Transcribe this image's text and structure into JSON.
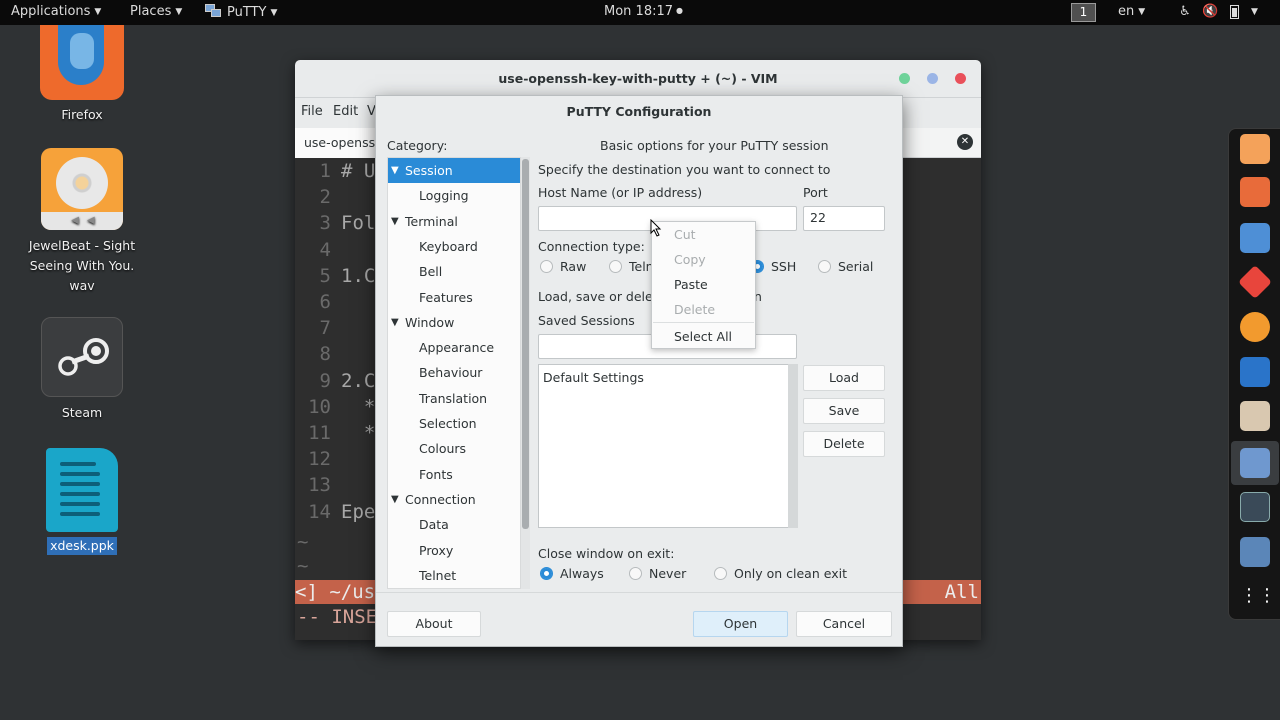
{
  "top_panel": {
    "applications": "Applications",
    "places": "Places",
    "app_menu": "PuTTY",
    "clock": "Mon 18:17",
    "clock_dot": "●",
    "workspace": "1",
    "keyboard_layout": "en"
  },
  "desktop": {
    "icons": [
      {
        "label": "Firefox"
      },
      {
        "label": "JewelBeat - Sight Seeing With You. wav"
      },
      {
        "label": "Steam"
      },
      {
        "label": "xdesk.ppk"
      }
    ]
  },
  "vim_window": {
    "title": "use-openssh-key-with-putty + (~) - VIM",
    "menus": [
      "File",
      "Edit",
      "V"
    ],
    "tab_label": "use-openss",
    "lines": [
      {
        "num": "1",
        "text": "# U"
      },
      {
        "num": "2",
        "text": ""
      },
      {
        "num": "3",
        "text": "Fol"
      },
      {
        "num": "4",
        "text": ""
      },
      {
        "num": "5",
        "text": "1.C"
      },
      {
        "num": "6",
        "text": ""
      },
      {
        "num": "7",
        "text": ""
      },
      {
        "num": "8",
        "text": ""
      },
      {
        "num": "9",
        "text": "2.C"
      },
      {
        "num": "10",
        "text": "  *"
      },
      {
        "num": "11",
        "text": "  *"
      },
      {
        "num": "12",
        "text": ""
      },
      {
        "num": "13",
        "text": ""
      },
      {
        "num": "14",
        "text": "Epe"
      }
    ],
    "tilde": "~",
    "status_left": "<] ~/us",
    "status_right": "All",
    "cmdline": "-- INSE"
  },
  "putty": {
    "title": "PuTTY Configuration",
    "category_label": "Category:",
    "heading": "Basic options for your PuTTY session",
    "tree": [
      {
        "label": "Session",
        "level": 0,
        "expanded": true,
        "selected": true
      },
      {
        "label": "Logging",
        "level": 1
      },
      {
        "label": "Terminal",
        "level": 0,
        "expanded": true
      },
      {
        "label": "Keyboard",
        "level": 1
      },
      {
        "label": "Bell",
        "level": 1
      },
      {
        "label": "Features",
        "level": 1
      },
      {
        "label": "Window",
        "level": 0,
        "expanded": true
      },
      {
        "label": "Appearance",
        "level": 1
      },
      {
        "label": "Behaviour",
        "level": 1
      },
      {
        "label": "Translation",
        "level": 1
      },
      {
        "label": "Selection",
        "level": 1
      },
      {
        "label": "Colours",
        "level": 1
      },
      {
        "label": "Fonts",
        "level": 1
      },
      {
        "label": "Connection",
        "level": 0,
        "expanded": true
      },
      {
        "label": "Data",
        "level": 1
      },
      {
        "label": "Proxy",
        "level": 1
      },
      {
        "label": "Telnet",
        "level": 1
      }
    ],
    "tree_arrow": "▼",
    "destination_label": "Specify the destination you want to connect to",
    "host_label": "Host Name (or IP address)",
    "host_value": "",
    "port_label": "Port",
    "port_value": "22",
    "conn_type_label": "Connection type:",
    "conn_types": [
      {
        "label": "Raw",
        "checked": false
      },
      {
        "label": "Teln",
        "checked": false
      },
      {
        "label": "SSH",
        "checked": true
      },
      {
        "label": "Serial",
        "checked": false
      }
    ],
    "load_save_label": "Load, save or delet",
    "load_save_suffix": "n",
    "saved_sessions_label": "Saved Sessions",
    "saved_session_value": "",
    "sessions": [
      "Default Settings"
    ],
    "load_button": "Load",
    "save_button": "Save",
    "delete_button": "Delete",
    "close_label": "Close window on exit:",
    "close_options": [
      {
        "label": "Always",
        "checked": true
      },
      {
        "label": "Never",
        "checked": false
      },
      {
        "label": "Only on clean exit",
        "checked": false
      }
    ],
    "about_button": "About",
    "open_button": "Open",
    "cancel_button": "Cancel"
  },
  "context_menu": {
    "items": [
      {
        "label": "Cut",
        "enabled": false
      },
      {
        "label": "Copy",
        "enabled": false
      },
      {
        "label": "Paste",
        "enabled": true
      },
      {
        "label": "Delete",
        "enabled": false
      },
      {
        "label": "Select All",
        "enabled": true
      }
    ]
  },
  "dock": {
    "icons": [
      "files-icon",
      "firefox-icon",
      "chromium-icon",
      "git-icon",
      "vlc-icon",
      "meter-icon",
      "text-editor-icon",
      "putty-icon",
      "terminal-icon",
      "network-icon",
      "app-grid-icon"
    ]
  },
  "colors": {
    "accent": "#2a8bd7",
    "vim_status": "#c4624a",
    "panel": "#0a0a0a"
  }
}
